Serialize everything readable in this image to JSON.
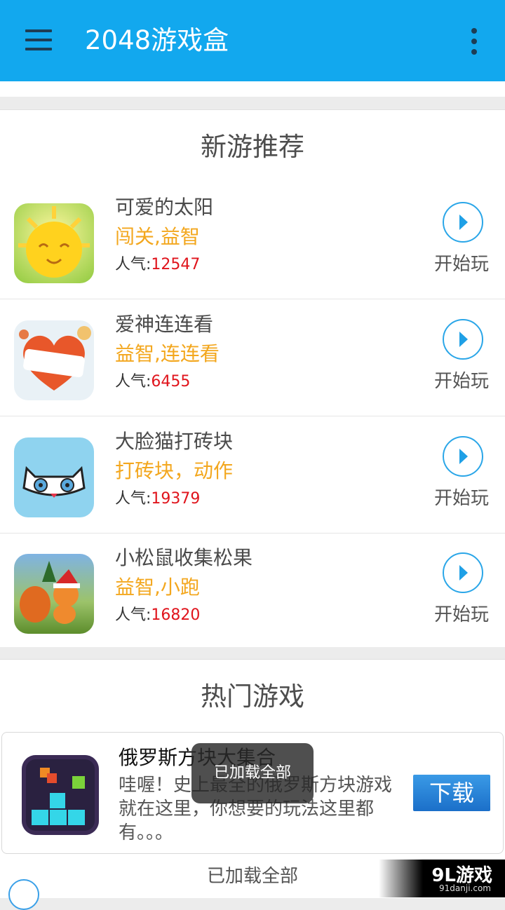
{
  "app_bar": {
    "title": "2048游戏盒",
    "menu_icon": "hamburger-menu-icon",
    "more_icon": "overflow-menu-icon",
    "background": "#12a8ee"
  },
  "new_games": {
    "section_title": "新游推荐",
    "items": [
      {
        "name": "可爱的太阳",
        "tags": "闯关,益智",
        "popularity_label": "人气:",
        "popularity": "12547",
        "play_label": "开始玩",
        "icon": "smiling-sun-icon"
      },
      {
        "name": "爱神连连看",
        "tags": "益智,连连看",
        "popularity_label": "人气:",
        "popularity": "6455",
        "play_label": "开始玩",
        "icon": "love-heart-match-icon"
      },
      {
        "name": "大脸猫打砖块",
        "tags": "打砖块，动作",
        "popularity_label": "人气:",
        "popularity": "19379",
        "play_label": "开始玩",
        "icon": "cat-face-icon"
      },
      {
        "name": "小松鼠收集松果",
        "tags": "益智,小跑",
        "popularity_label": "人气:",
        "popularity": "16820",
        "play_label": "开始玩",
        "icon": "squirrel-santa-hat-icon"
      }
    ]
  },
  "hot_games": {
    "section_title": "热门游戏",
    "item": {
      "name": "俄罗斯方块大集合",
      "description": "哇喔！史上最全的俄罗斯方块游戏就在这里，你想要的玩法这里都有。。。",
      "download_label": "下载",
      "icon": "tetris-blocks-icon"
    }
  },
  "footer": {
    "loaded_text": "已加载全部"
  },
  "toast": {
    "text": "已加载全部"
  },
  "watermark": {
    "logo": "9L游戏",
    "url": "91danji.com"
  },
  "colors": {
    "accent": "#12a8ee",
    "tag": "#f3a71e",
    "popularity": "#e0141c"
  }
}
